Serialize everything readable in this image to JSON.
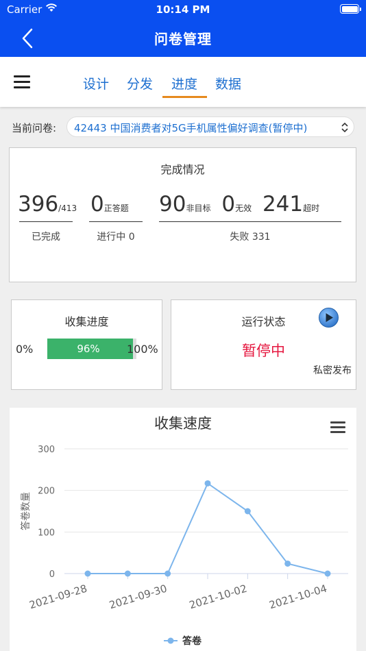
{
  "status_bar": {
    "carrier": "Carrier",
    "time": "10:14 PM"
  },
  "nav": {
    "title": "问卷管理"
  },
  "tabs": [
    {
      "label": "设计"
    },
    {
      "label": "分发"
    },
    {
      "label": "进度"
    },
    {
      "label": "数据"
    }
  ],
  "active_tab": 2,
  "survey_selector": {
    "label": "当前问卷:",
    "value": "42443 中国消费者对5G手机属性偏好调查(暂停中)"
  },
  "completion": {
    "title": "完成情况",
    "completed": "396",
    "total": "/413",
    "completed_caption": "已完成",
    "correct": "0",
    "correct_label": "正答题",
    "in_progress_caption": "进行中 0",
    "non_target": "90",
    "non_target_label": "非目标",
    "invalid": "0",
    "invalid_label": "无效",
    "timeout": "241",
    "timeout_label": "超时",
    "failed_caption": "失败 331"
  },
  "progress": {
    "title": "收集进度",
    "min_label": "0%",
    "max_label": "100%",
    "value_label": "96%",
    "value": 96
  },
  "run_status": {
    "title": "运行状态",
    "status": "暂停中",
    "publish": "私密发布"
  },
  "colors": {
    "header": "#0a4ff0",
    "tab": "#1d6fd0",
    "underline": "#e68a1e",
    "bar": "#3bb26a",
    "status": "#e5173f",
    "series": "#7cb5ec"
  },
  "chart_data": {
    "type": "line",
    "title": "收集速度",
    "ylabel": "答卷数量",
    "xlabel": "",
    "x": [
      "2021-09-28",
      "2021-09-29",
      "2021-09-30",
      "2021-10-01",
      "2021-10-02",
      "2021-10-03",
      "2021-10-04"
    ],
    "x_tick_labels": [
      "2021-09-28",
      "2021-09-30",
      "2021-10-02",
      "2021-10-04"
    ],
    "y_ticks": [
      0,
      100,
      200,
      300
    ],
    "ylim": [
      0,
      300
    ],
    "series": [
      {
        "name": "答卷",
        "values": [
          0,
          0,
          0,
          217,
          150,
          24,
          0
        ]
      }
    ],
    "grid": true,
    "legend": "bottom-center"
  }
}
